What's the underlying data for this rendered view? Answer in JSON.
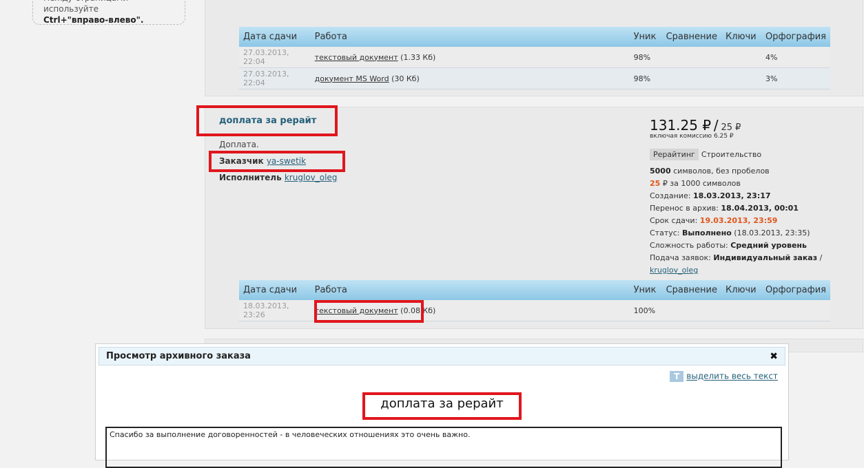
{
  "hint": {
    "line1": "между страницами используйте",
    "keys": "Ctrl+\"вправо-влево\"."
  },
  "columns": {
    "date": "Дата сдачи",
    "work": "Работа",
    "unique": "Уник",
    "compare": "Сравнение",
    "keys": "Ключи",
    "spelling": "Орфография"
  },
  "top_rows": [
    {
      "date": "27.03.2013, 22:04",
      "doc": "текстовый документ",
      "size": "(1.33 Кб)",
      "unique": "98%",
      "spelling": "4%"
    },
    {
      "date": "27.03.2013, 22:04",
      "doc": "документ MS Word",
      "size": "(30 Кб)",
      "unique": "98%",
      "spelling": "3%"
    }
  ],
  "order": {
    "title": "доплата за рерайт",
    "description": "Доплата.",
    "client_label": "Заказчик",
    "client": "ya-swetik",
    "executor_label": "Исполнитель",
    "executor": "kruglov_oleg",
    "price": "131.25 ₽",
    "price_sep": "/",
    "price_sub": "25 ₽",
    "commission": "включая комиссию 6.25 ₽",
    "tag": "Рерайтинг",
    "category": "Строительство",
    "chars_count": "5000",
    "chars_text": "символов, без пробелов",
    "rate": "25",
    "rate_text": "₽ за 1000 символов",
    "created_label": "Создание:",
    "created": "18.03.2013, 23:17",
    "archived_label": "Перенос в архив:",
    "archived": "18.04.2013, 00:01",
    "deadline_label": "Срок сдачи:",
    "deadline": "19.03.2013, 23:59",
    "status_label": "Статус:",
    "status": "Выполнено",
    "status_date": "(18.03.2013, 23:35)",
    "complexity_label": "Сложность работы:",
    "complexity": "Средний уровень",
    "bids_label": "Подача заявок:",
    "bids": "Индивидуальный заказ",
    "bids_sep": "/",
    "bids_user": "kruglov_oleg",
    "rows": [
      {
        "date": "18.03.2013, 23:26",
        "doc": "текстовый документ",
        "size": "(0.08 Кб)",
        "unique": "100%",
        "spelling": ""
      }
    ]
  },
  "modal": {
    "header": "Просмотр архивного заказа",
    "close": "✖",
    "select_all_icon": "T",
    "select_all": "выделить весь текст",
    "title": "доплата за рерайт",
    "text": "Спасибо за выполнение договоренностей - в человеческих отношениях это очень важно."
  },
  "highlight_color": "#e0161d"
}
